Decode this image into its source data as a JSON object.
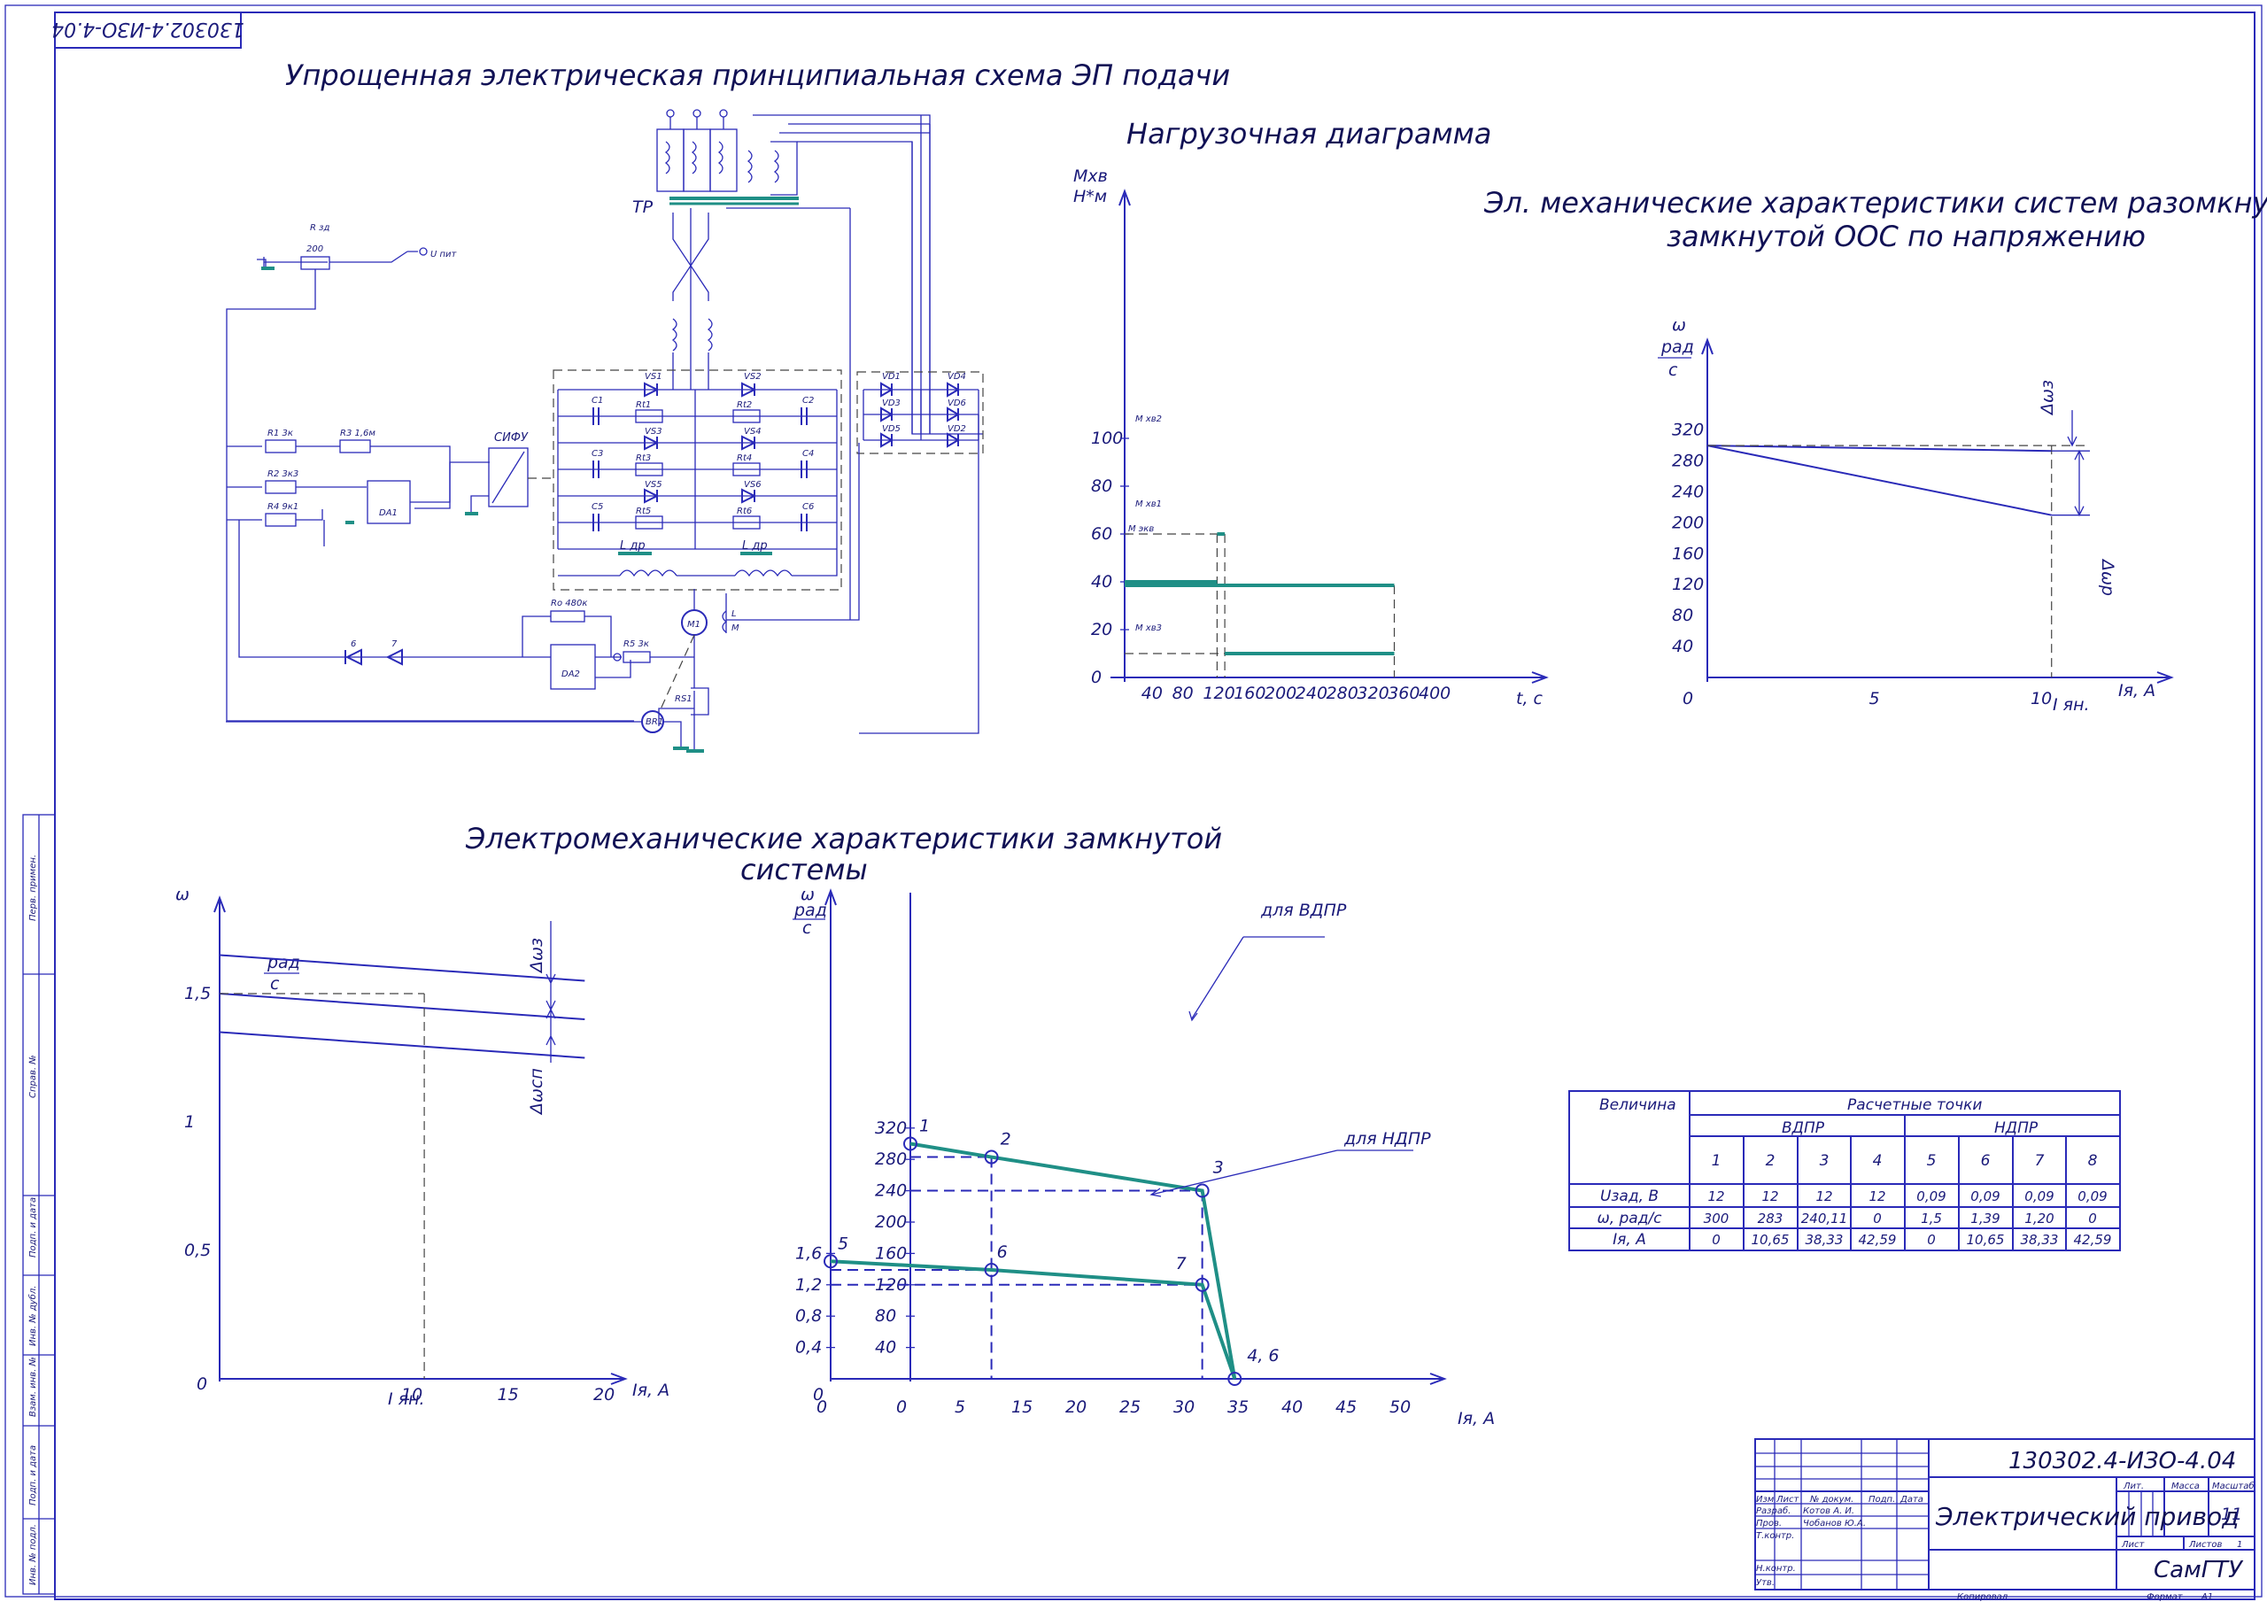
{
  "stamp_code_rotated": "130302.4-ИЗО-4.04",
  "titles": {
    "scheme": "Упрощенная электрическая принципиальная схема ЭП подачи",
    "load": "Нагрузочная диаграмма",
    "elmech_1": "Эл. механические характеристики систем разомкнутой и",
    "elmech_2": "замкнутой ООС по напряжению",
    "closed_1": "Электромеханические характеристики замкнутой",
    "closed_2": "системы"
  },
  "scheme": {
    "rzd": "R зд",
    "r200": "200",
    "upit": "U пит",
    "tr": "ТР",
    "r1": "R1  3к",
    "r3": "R3  1,6м",
    "r2": "R2  3к3",
    "r4": "R4  9к1",
    "da1": "DA1",
    "sifu": "СИФУ",
    "da2": "DA2",
    "ro": "Ro 480к",
    "r5": "R5 3к",
    "m1": "M1",
    "lm": "L",
    "lm2": "M",
    "br1": "BR1",
    "rs1": "RS1",
    "ldr": "L др",
    "vs": [
      "VS1",
      "VS2",
      "VS3",
      "VS4",
      "VS5",
      "VS6"
    ],
    "rt": [
      "Rt1",
      "Rt2",
      "Rt3",
      "Rt4",
      "Rt5",
      "Rt6"
    ],
    "c": [
      "C1",
      "C2",
      "C3",
      "C4",
      "C5",
      "C6"
    ],
    "vd": [
      "VD1",
      "VD4",
      "VD3",
      "VD6",
      "VD5",
      "VD2"
    ],
    "d6": "6",
    "d7": "7"
  },
  "load_chart": {
    "ylabel_1": "Мхв",
    "ylabel_2": "Н*м",
    "xlabel": "t, c",
    "y_ticks": [
      "0",
      "20",
      "40",
      "60",
      "80",
      "100"
    ],
    "x_ticks": [
      "40",
      "80",
      "120",
      "160",
      "200",
      "240",
      "280",
      "320",
      "360",
      "400"
    ],
    "labels": {
      "m_hv2": "M хв2",
      "m_hv1": "M хв1",
      "m_ehv": "M экв",
      "m_hv3": "M хв3"
    }
  },
  "open_chart": {
    "ylabel_1": "ω",
    "ylabel_2": "рад",
    "ylabel_3": "с",
    "y_ticks": [
      "40",
      "80",
      "120",
      "160",
      "200",
      "240",
      "280",
      "320"
    ],
    "x_ticks": [
      "0",
      "5",
      "10"
    ],
    "x_extra": "I ян.",
    "xlabel": "Iя, A",
    "d_omega_z": "Δωз",
    "d_omega_r": "Δωр"
  },
  "left_chart": {
    "ylabel": "ω",
    "unit_num": "рад",
    "unit_den": "с",
    "y_ticks": [
      "0",
      "0,5",
      "1",
      "1,5"
    ],
    "x_ticks": [
      "10",
      "15",
      "20"
    ],
    "x_extra": "I ян.",
    "xlabel": "Iя, A",
    "d_omega_z": "Δωз",
    "d_omega_sp": "Δωсп"
  },
  "closed_chart": {
    "ylabel_1": "ω",
    "ylabel_2": "рад",
    "ylabel_3": "с",
    "y_ticks_outer": [
      "0",
      "0,4",
      "0,8",
      "1,2",
      "1,6"
    ],
    "y_ticks_inner": [
      "40",
      "80",
      "120",
      "160",
      "200",
      "240",
      "280",
      "320"
    ],
    "x_ticks": [
      "0",
      "0",
      "5",
      "15",
      "20",
      "25",
      "30",
      "35",
      "40",
      "45",
      "50"
    ],
    "xlabel": "Iя, A",
    "vdpr": "для ВДПР",
    "ndpr": "для НДПР",
    "points": [
      "1",
      "2",
      "3",
      "4, 6",
      "5",
      "6",
      "7"
    ]
  },
  "chart_data": [
    {
      "type": "line",
      "title": "Нагрузочная диаграмма",
      "xlabel": "t, c",
      "ylabel": "Мхв Н*м",
      "xlim": [
        0,
        400
      ],
      "ylim": [
        0,
        100
      ],
      "series": [
        {
          "name": "M хв2",
          "x": [
            120,
            130
          ],
          "y": [
            60,
            60
          ]
        },
        {
          "name": "M хв1",
          "x": [
            0,
            120
          ],
          "y": [
            40,
            40
          ]
        },
        {
          "name": "M экв",
          "x": [
            0,
            350
          ],
          "y": [
            38.5,
            38.5
          ]
        },
        {
          "name": "M хв3",
          "x": [
            130,
            350
          ],
          "y": [
            10,
            10
          ]
        }
      ]
    },
    {
      "type": "line",
      "title": "Эл. механические характеристики систем разомкнутой и замкнутой ООС по напряжению",
      "xlabel": "Iя, A",
      "ylabel": "ω рад/с",
      "xlim": [
        0,
        14
      ],
      "ylim": [
        0,
        340
      ],
      "series": [
        {
          "x": [
            0,
            10.65
          ],
          "y": [
            300,
            293
          ]
        },
        {
          "x": [
            0,
            10.65
          ],
          "y": [
            300,
            210
          ]
        }
      ]
    },
    {
      "type": "line",
      "xlabel": "Iя, A",
      "ylabel": "ω",
      "xlim": [
        0,
        20
      ],
      "ylim": [
        0,
        1.8
      ],
      "series": [
        {
          "x": [
            0,
            19
          ],
          "y": [
            1.65,
            1.55
          ]
        },
        {
          "x": [
            0,
            19
          ],
          "y": [
            1.5,
            1.4
          ]
        },
        {
          "x": [
            0,
            19
          ],
          "y": [
            1.35,
            1.25
          ]
        }
      ]
    },
    {
      "type": "line",
      "title": "Электромеханические характеристики замкнутой системы",
      "xlabel": "Iя, A",
      "ylabel": "ω рад/с",
      "xlim": [
        0,
        50
      ],
      "ylim": [
        0,
        340
      ],
      "series": [
        {
          "name": "для ВДПР",
          "x": [
            0,
            10.65,
            38.33,
            42.59
          ],
          "y": [
            300,
            283,
            240.11,
            0
          ]
        },
        {
          "name": "для НДПР",
          "x": [
            0,
            10.65,
            38.33,
            42.59
          ],
          "y": [
            1.5,
            1.39,
            1.2,
            0
          ]
        }
      ]
    }
  ],
  "calc_table": {
    "col0": "Величина",
    "group": "Расчетные точки",
    "vdpr": "ВДПР",
    "ndpr": "НДПР",
    "nums": [
      "1",
      "2",
      "3",
      "4",
      "5",
      "6",
      "7",
      "8"
    ],
    "rows": [
      {
        "name": "Uзад, В",
        "vals": [
          "12",
          "12",
          "12",
          "12",
          "0,09",
          "0,09",
          "0,09",
          "0,09"
        ]
      },
      {
        "name": "ω, рад/с",
        "vals": [
          "300",
          "283",
          "240,11",
          "0",
          "1,5",
          "1,39",
          "1,20",
          "0"
        ]
      },
      {
        "name": "Iя, A",
        "vals": [
          "0",
          "10,65",
          "38,33",
          "42,59",
          "0",
          "10,65",
          "38,33",
          "42,59"
        ]
      }
    ]
  },
  "title_block": {
    "code": "130302.4-ИЗО-4.04",
    "name": "Электрический привод",
    "org": "СамГТУ",
    "lit": "Лит.",
    "mass": "Масса",
    "scale": "Масштаб",
    "scale_val": "11",
    "sheet": "Лист",
    "sheets": "Листов",
    "sheets_val": "1",
    "izm": "Изм",
    "list": "Лист",
    "doc": "№ докум.",
    "sign": "Подп.",
    "date": "Дата",
    "razrab": "Разраб.",
    "prov": "Пров.",
    "tkontr": "Т.контр.",
    "nkontr": "Н.контр.",
    "utv": "Утв.",
    "razrab_name": "Котов А. И.",
    "prov_name": "Чобанов Ю.А.",
    "copied": "Копировал",
    "format": "Формат",
    "format_val": "A1"
  },
  "side_stamps": [
    "Перв. примен.",
    "Справ. №",
    "Подп. и дата",
    "Инв. № дубл.",
    "Взам. инв. №",
    "Подп. и дата",
    "Инв. № подл."
  ]
}
